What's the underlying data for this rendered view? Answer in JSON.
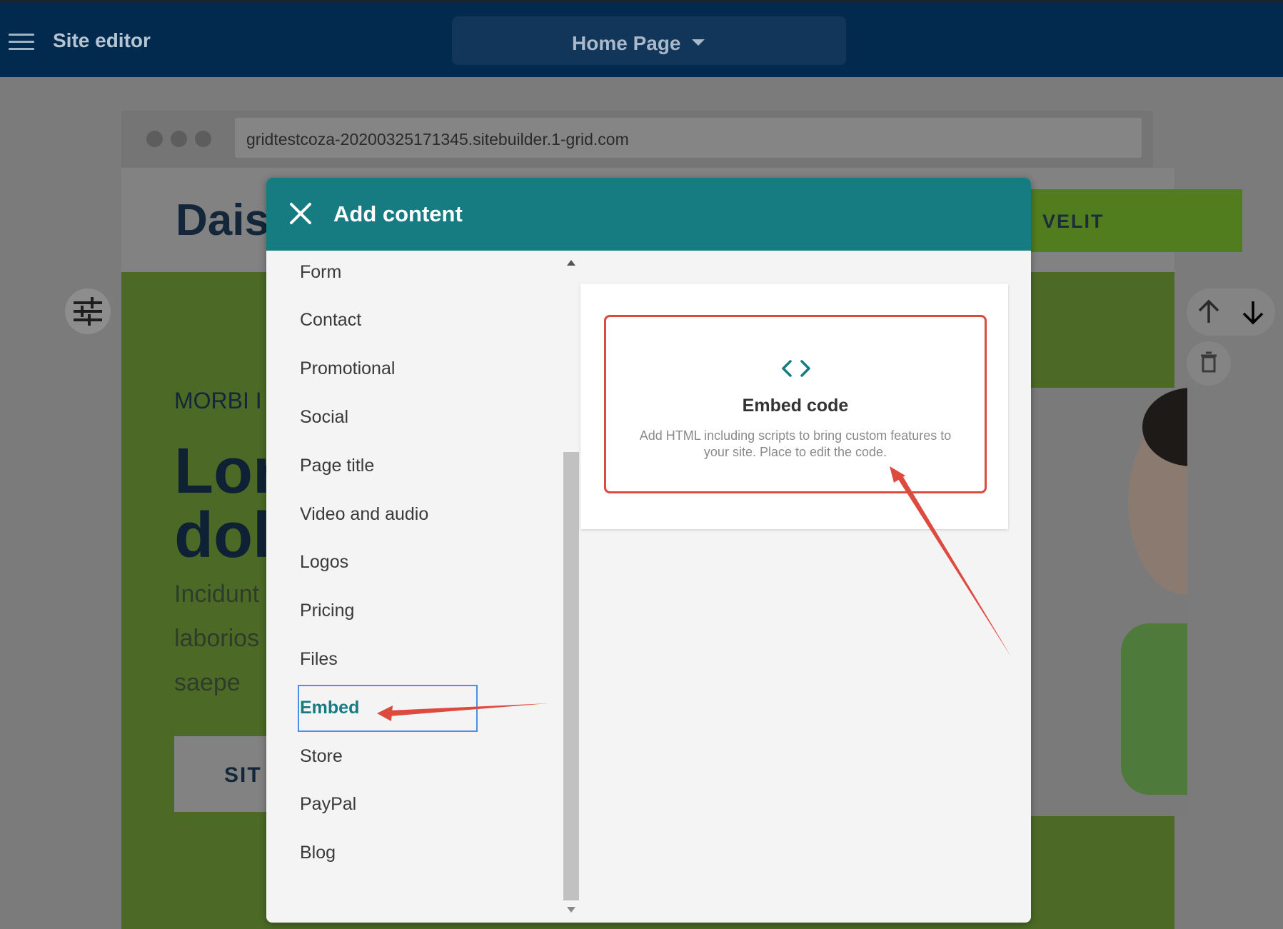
{
  "app": {
    "title": "Site editor",
    "current_page": "Home Page"
  },
  "preview": {
    "url": "gridtestcoza-20200325171345.sitebuilder.1-grid.com",
    "logo_text": "Dais",
    "header_button": "VELIT",
    "hero_kicker": "MORBI I",
    "hero_title_line1": "Lor",
    "hero_title_line2": "dol",
    "hero_body": [
      "Incidunt",
      "laborios",
      "saepe"
    ],
    "hero_button": "SIT"
  },
  "dialog": {
    "title": "Add content",
    "categories": [
      "Form",
      "Contact",
      "Promotional",
      "Social",
      "Page title",
      "Video and audio",
      "Logos",
      "Pricing",
      "Files",
      "Embed",
      "Store",
      "PayPal",
      "Blog"
    ],
    "selected_category": "Embed",
    "card": {
      "title": "Embed code",
      "description": "Add HTML including scripts to bring custom features to your site. Place to edit the code.",
      "icon": "code-brackets-icon"
    }
  },
  "colors": {
    "topbar": "#022a4f",
    "dialog_header": "#177c82",
    "selected_text": "#177c82",
    "annotation": "#dc4b3e",
    "focus_outline": "#4a90e2"
  }
}
